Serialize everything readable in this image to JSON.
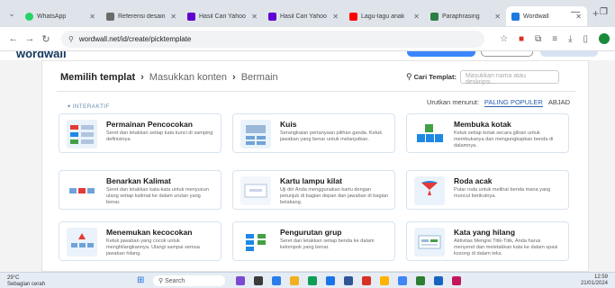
{
  "browser": {
    "tabs": [
      {
        "title": "WhatsApp",
        "color": "#25d366",
        "active": false
      },
      {
        "title": "Referensi desain",
        "color": "#6b6b6b",
        "active": false
      },
      {
        "title": "Hasil Cari Yahoo",
        "color": "#5f01d1",
        "active": false
      },
      {
        "title": "Hasil Cari Yahoo",
        "color": "#5f01d1",
        "active": false
      },
      {
        "title": "Lagu-lagu anak",
        "color": "#ff0000",
        "active": false
      },
      {
        "title": "Paraphrasing",
        "color": "#2d7d46",
        "active": false
      },
      {
        "title": "Wordwall",
        "color": "#1f7ae0",
        "active": true
      }
    ],
    "url": "wordwall.net/id/create/picktemplate"
  },
  "page": {
    "breadcrumb": {
      "step1": "Memilih templat",
      "step2": "Masukkan konten",
      "step3": "Bermain"
    },
    "search": {
      "label": "Cari Templat:",
      "placeholder": "Masukkan nama atau deskripsi..."
    },
    "sort": {
      "label": "Urutkan menurut:",
      "option1": "PALING POPULER",
      "option2": "ABJAD"
    },
    "filter_label": "INTERAKTIF",
    "cards": [
      {
        "title": "Permainan Pencocokan",
        "desc": "Seret dan letakkan setiap kata kunci di samping definisinya.",
        "color": "#e9f2fb"
      },
      {
        "title": "Kuis",
        "desc": "Serangkaian pertanyaan pilihan ganda. Ketuk jawaban yang benar untuk melanjutkan.",
        "color": "#e9f2fb"
      },
      {
        "title": "Membuka kotak",
        "desc": "Ketuk setiap kotak secara giliran untuk membukanya dan mengungkapkan benda di dalamnya.",
        "color": "#ffffff"
      },
      {
        "title": "Benarkan Kalimat",
        "desc": "Seret dan letakkan kata-kata untuk menyusun ulang setiap kalimat ke dalam urutan yang benar.",
        "color": "#ffffff"
      },
      {
        "title": "Kartu lampu kilat",
        "desc": "Uji diri Anda menggunakan kartu dengan petunjuk di bagian depan dan jawaban di bagian belakang.",
        "color": "#f3f6fa"
      },
      {
        "title": "Roda acak",
        "desc": "Putar roda untuk melihat benda mana yang muncul berikutnya.",
        "color": "#e9f2fb"
      },
      {
        "title": "Menemukan kecocokan",
        "desc": "Ketuk jawaban yang cocok untuk menghilangkannya. Ulangi sampai semua jawaban hilang.",
        "color": "#e9f2fb"
      },
      {
        "title": "Pengurutan grup",
        "desc": "Seret dan letakkan setiap benda ke dalam kelompok yang benar.",
        "color": "#ffffff"
      },
      {
        "title": "Kata yang hilang",
        "desc": "Aktivitas Mengisi Titik-Titik, Anda harus menyeret dan meletakkan kata ke dalam spasi kosong di dalam teks.",
        "color": "#e9f2fb"
      }
    ]
  },
  "taskbar": {
    "weather_temp": "29°C",
    "weather_text": "Sebagian cerah",
    "search_label": "Search",
    "time": "12:59",
    "date": "21/01/2024"
  }
}
